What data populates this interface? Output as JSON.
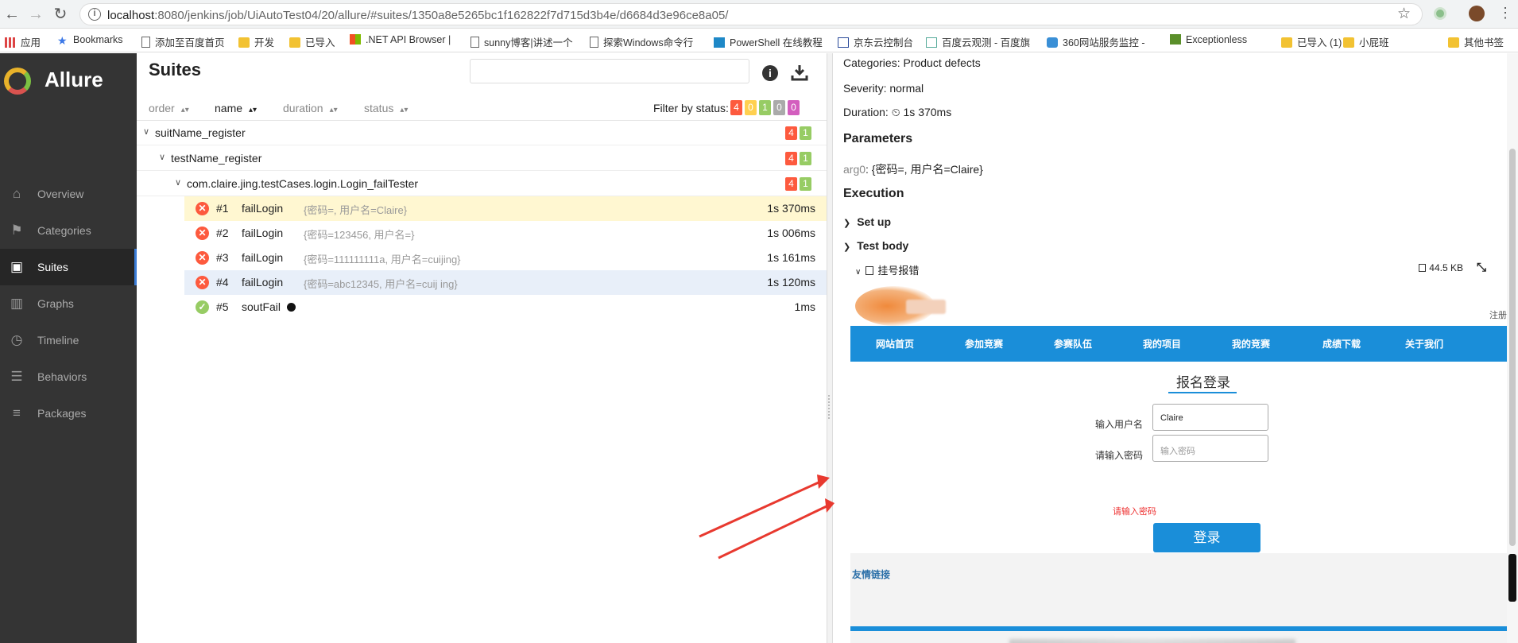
{
  "browser": {
    "url_host": "localhost",
    "url_path": ":8080/jenkins/job/UiAutoTest04/20/allure/#suites/1350a8e5265bc1f162822f7d715d3b4e/d6684d3e96ce8a05/"
  },
  "bookmarks": [
    {
      "label": "应用",
      "icon": "apps-icon"
    },
    {
      "label": "Bookmarks",
      "icon": "star-icon"
    },
    {
      "label": "添加至百度首页",
      "icon": "page-icon"
    },
    {
      "label": "开发",
      "icon": "folder-icon"
    },
    {
      "label": "已导入",
      "icon": "folder-icon"
    },
    {
      "label": ".NET API Browser | ",
      "icon": "windows-icon"
    },
    {
      "label": "sunny博客|讲述一个",
      "icon": "page-icon"
    },
    {
      "label": "探索Windows命令行",
      "icon": "page-icon"
    },
    {
      "label": "PowerShell 在线教程",
      "icon": "powershell-icon"
    },
    {
      "label": "京东云控制台",
      "icon": "jd-icon"
    },
    {
      "label": "百度云观测 - 百度旗",
      "icon": "monitor-icon"
    },
    {
      "label": "360网站服务监控 - ",
      "icon": "cloud-icon"
    },
    {
      "label": "Exceptionless",
      "icon": "exceptionless-icon"
    },
    {
      "label": "已导入 (1)",
      "icon": "folder-icon"
    },
    {
      "label": "小屁班",
      "icon": "folder-icon"
    },
    {
      "label": "其他书签",
      "icon": "folder-icon"
    }
  ],
  "sidebar": {
    "brand": "Allure",
    "items": [
      {
        "label": "Overview",
        "icon": "home-icon"
      },
      {
        "label": "Categories",
        "icon": "flag-icon"
      },
      {
        "label": "Suites",
        "icon": "briefcase-icon",
        "active": true
      },
      {
        "label": "Graphs",
        "icon": "bar-chart-icon"
      },
      {
        "label": "Timeline",
        "icon": "clock-icon"
      },
      {
        "label": "Behaviors",
        "icon": "list-icon"
      },
      {
        "label": "Packages",
        "icon": "align-left-icon"
      }
    ]
  },
  "suites": {
    "title": "Suites",
    "search_value": "",
    "sort_columns": [
      "order",
      "name",
      "duration",
      "status"
    ],
    "filter_label": "Filter by status:",
    "filter_counts": [
      {
        "value": "4",
        "color": "#fd5a3e"
      },
      {
        "value": "0",
        "color": "#ffd050"
      },
      {
        "value": "1",
        "color": "#97cc64"
      },
      {
        "value": "0",
        "color": "#aaaaaa"
      },
      {
        "value": "0",
        "color": "#d35ebe"
      }
    ],
    "tree": [
      {
        "name": "suitName_register",
        "failed": "4",
        "passed": "1"
      },
      {
        "name": "testName_register",
        "failed": "4",
        "passed": "1"
      },
      {
        "name": "com.claire.jing.testCases.login.Login_failTester",
        "failed": "4",
        "passed": "1"
      }
    ],
    "cases": [
      {
        "num": "#1",
        "name": "failLogin",
        "params": "{密码=, 用户名=Claire}",
        "duration": "1s 370ms",
        "status": "failed"
      },
      {
        "num": "#2",
        "name": "failLogin",
        "params": "{密码=123456, 用户名=}",
        "duration": "1s 006ms",
        "status": "failed"
      },
      {
        "num": "#3",
        "name": "failLogin",
        "params": "{密码=111111111a, 用户名=cuijing}",
        "duration": "1s 161ms",
        "status": "failed"
      },
      {
        "num": "#4",
        "name": "failLogin",
        "params": "{密码=abc12345, 用户名=cuij ing}",
        "duration": "1s 120ms",
        "status": "failed"
      },
      {
        "num": "#5",
        "name": "soutFail",
        "params": "",
        "duration": "1ms",
        "status": "passed"
      }
    ]
  },
  "detail": {
    "categories": "Categories: Product defects",
    "severity": "Severity: normal",
    "duration_label": "Duration:",
    "duration_value": "1s 370ms",
    "parameters_heading": "Parameters",
    "param_key": "arg0",
    "param_value": ": {密码=, 用户名=Claire}",
    "execution_heading": "Execution",
    "setup_label": "Set up",
    "testbody_label": "Test body",
    "attachment_name": "挂号报错",
    "attachment_size": "44.5 KB"
  },
  "embedded_page": {
    "top_right": "注册",
    "nav": [
      "网站首页",
      "参加竞赛",
      "参赛队伍",
      "我的项目",
      "我的竞赛",
      "成绩下载",
      "关于我们"
    ],
    "title": "报名登录",
    "username_label": "输入用户名",
    "username_value": "Claire",
    "password_label": "请输入密码",
    "password_placeholder": "输入密码",
    "error_text": "请输入密码",
    "login_button": "登录",
    "friend_links": "友情链接"
  }
}
